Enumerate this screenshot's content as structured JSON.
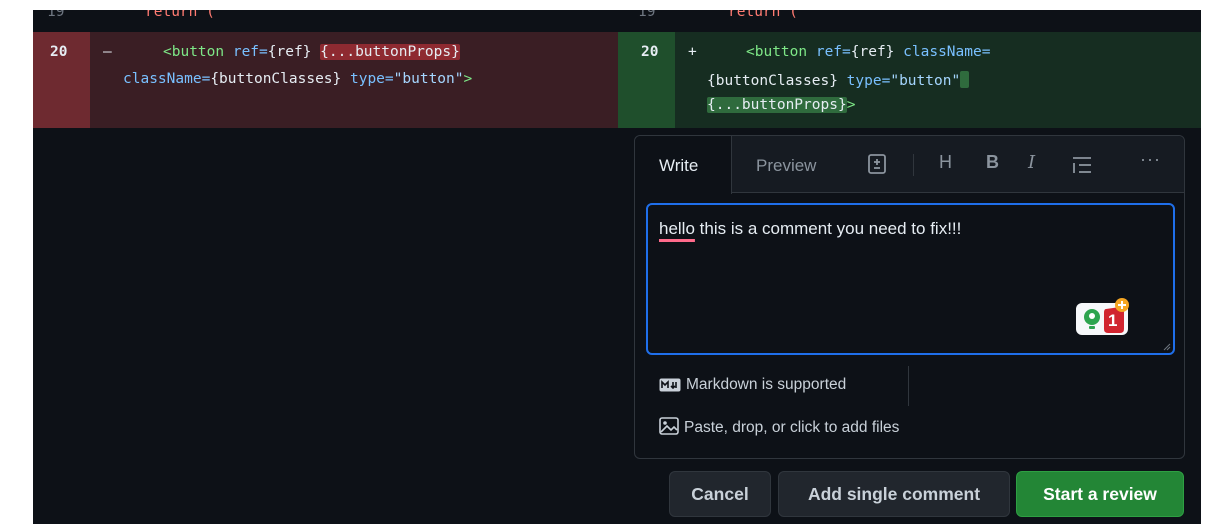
{
  "diff": {
    "left": {
      "context_line": {
        "number": "19",
        "code": "return ("
      },
      "deleted_line": {
        "number": "20",
        "sign": "–",
        "code_part1_tag": "<button",
        "code_part1_attr": " ref=",
        "code_part1_val": "{ref} ",
        "code_part1_hl": "{...buttonProps}",
        "code_part2_attr": "className=",
        "code_part2_val": "{buttonClasses}",
        "code_part2_attr2": " type=",
        "code_part2_str": "\"button\"",
        "code_part2_end": ">"
      }
    },
    "right": {
      "context_line": {
        "number": "19",
        "code": "return ("
      },
      "added_line": {
        "number": "20",
        "sign": "+",
        "code_part1_tag": "<button",
        "code_part1_attr": " ref=",
        "code_part1_val": "{ref}",
        "code_part1_attr2": " className=",
        "code_part2_val": "{buttonClasses}",
        "code_part2_attr": " type=",
        "code_part2_str": "\"button\"",
        "code_part3_val": "{...buttonProps}",
        "code_part3_end": ">"
      }
    }
  },
  "comment": {
    "tabs": {
      "write": "Write",
      "preview": "Preview"
    },
    "toolbar": {
      "heading": "H",
      "bold": "B",
      "italic": "I",
      "more": "···"
    },
    "text": {
      "misspelled": "hello",
      "rest": " this is a comment you need to fix!!!"
    },
    "widget_badge": "1",
    "markdown_note": "Markdown is supported",
    "files_note": "Paste, drop, or click to add files"
  },
  "buttons": {
    "cancel": "Cancel",
    "single": "Add single comment",
    "review": "Start a review"
  },
  "colors": {
    "background": "#0d1117",
    "deletion_bg": "#3a1e24",
    "addition_bg": "#162d21",
    "focus_border": "#1f6feb",
    "primary_button": "#238636"
  }
}
